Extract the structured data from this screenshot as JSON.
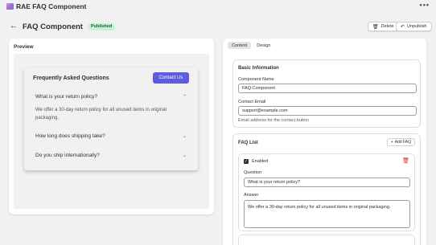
{
  "titlebar": {
    "title": "RAE FAQ Component",
    "more_icon": "more-horizontal-icon"
  },
  "header": {
    "title": "FAQ Component",
    "status_badge": "Published",
    "delete_label": "Delete",
    "unpublish_label": "Unpublish"
  },
  "preview": {
    "label": "Preview",
    "faq_heading": "Frequently Asked Questions",
    "contact_button": "Contact Us",
    "items": [
      {
        "question": "What is your return policy?",
        "answer": "We offer a 30-day return policy for all unused items in original packaging.",
        "expanded": true
      },
      {
        "question": "How long does shipping take?",
        "expanded": false
      },
      {
        "question": "Do you ship internationally?",
        "expanded": false
      }
    ]
  },
  "editor": {
    "tabs": [
      "Content",
      "Design"
    ],
    "active_tab": "Content",
    "basic_info": {
      "title": "Basic Information",
      "component_name_label": "Component Name",
      "component_name_value": "FAQ Component",
      "contact_email_label": "Contact Email",
      "contact_email_value": "support@example.com",
      "contact_email_help": "Email address for the contact button"
    },
    "faq_list": {
      "title": "FAQ List",
      "add_label": "Add FAQ",
      "item": {
        "enabled_label": "Enabled",
        "question_label": "Question",
        "question_value": "What is your return policy?",
        "answer_label": "Answer",
        "answer_value": "We offer a 30-day return policy for all unused items in original packaging."
      }
    }
  },
  "colors": {
    "accent": "#5c5ce0",
    "badge_bg": "#c9f2d5",
    "badge_text": "#16623a",
    "danger": "#d82c0d"
  }
}
